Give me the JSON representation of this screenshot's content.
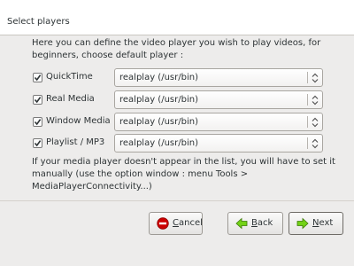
{
  "header": {
    "title": "Select players"
  },
  "intro": "Here you can define the video player you wish to play videos, for beginners, choose default player :",
  "players": [
    {
      "label": "QuickTime",
      "checked": true,
      "value": "realplay (/usr/bin)"
    },
    {
      "label": "Real Media",
      "checked": true,
      "value": "realplay (/usr/bin)"
    },
    {
      "label": "Window Media",
      "checked": true,
      "value": "realplay (/usr/bin)"
    },
    {
      "label": "Playlist / MP3",
      "checked": true,
      "value": "realplay (/usr/bin)"
    }
  ],
  "note": "If your media player doesn't appear in the list, you will have to set it manually (use the option window : menu Tools > MediaPlayerConnectivity...)",
  "buttons": {
    "cancel": {
      "mnemonic": "C",
      "rest": "ancel",
      "icon": "cancel-icon",
      "color": "#cc0000"
    },
    "back": {
      "mnemonic": "B",
      "rest": "ack",
      "icon": "back-arrow-icon",
      "color": "#4e9a06"
    },
    "next": {
      "mnemonic": "N",
      "rest": "ext",
      "icon": "next-arrow-icon",
      "color": "#4e9a06"
    }
  }
}
